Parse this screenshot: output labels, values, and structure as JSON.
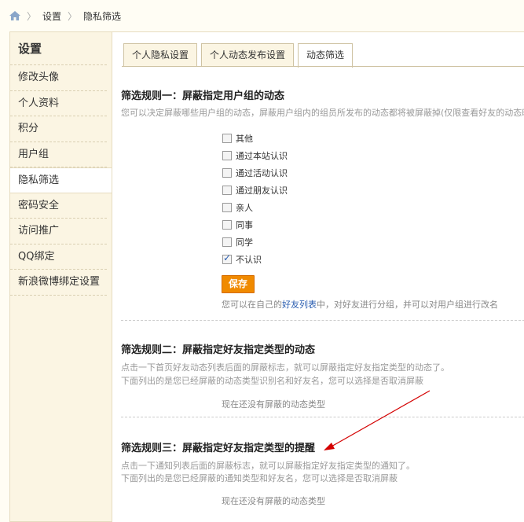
{
  "breadcrumb": {
    "home_icon": "home-icon",
    "items": [
      "设置",
      "隐私筛选"
    ]
  },
  "sidebar": {
    "title": "设置",
    "items": [
      {
        "label": "修改头像"
      },
      {
        "label": "个人资料"
      },
      {
        "label": "积分"
      },
      {
        "label": "用户组"
      },
      {
        "label": "隐私筛选",
        "active": true
      },
      {
        "label": "密码安全"
      },
      {
        "label": "访问推广"
      },
      {
        "label": "QQ绑定"
      },
      {
        "label": "新浪微博绑定设置"
      }
    ]
  },
  "tabs": [
    {
      "label": "个人隐私设置"
    },
    {
      "label": "个人动态发布设置"
    },
    {
      "label": "动态筛选",
      "active": true
    }
  ],
  "rule1": {
    "title": "筛选规则一：屏蔽指定用户组的动态",
    "desc": "您可以决定屏蔽哪些用户组的动态，屏蔽用户组内的组员所发布的动态都将被屏蔽掉(仅限查看好友的动态时",
    "options": [
      {
        "label": "其他",
        "checked": false
      },
      {
        "label": "通过本站认识",
        "checked": false
      },
      {
        "label": "通过活动认识",
        "checked": false
      },
      {
        "label": "通过朋友认识",
        "checked": false
      },
      {
        "label": "亲人",
        "checked": false
      },
      {
        "label": "同事",
        "checked": false
      },
      {
        "label": "同学",
        "checked": false
      },
      {
        "label": "不认识",
        "checked": true
      }
    ],
    "save_label": "保存",
    "note_prefix": "您可以在自己的",
    "note_link": "好友列表",
    "note_suffix": "中，对好友进行分组，并可以对用户组进行改名"
  },
  "rule2": {
    "title": "筛选规则二：屏蔽指定好友指定类型的动态",
    "desc1": "点击一下首页好友动态列表后面的屏蔽标志，就可以屏蔽指定好友指定类型的动态了。",
    "desc2": "下面列出的是您已经屏蔽的动态类型识别名和好友名，您可以选择是否取消屏蔽",
    "empty": "现在还没有屏蔽的动态类型"
  },
  "rule3": {
    "title": "筛选规则三：屏蔽指定好友指定类型的提醒",
    "desc1": "点击一下通知列表后面的屏蔽标志，就可以屏蔽指定好友指定类型的通知了。",
    "desc2": "下面列出的是您已经屏蔽的通知类型和好友名，您可以选择是否取消屏蔽",
    "empty": "现在还没有屏蔽的动态类型"
  },
  "colors": {
    "accent": "#f08a00",
    "link": "#2a5db0",
    "annotation_arrow": "#d40000"
  }
}
